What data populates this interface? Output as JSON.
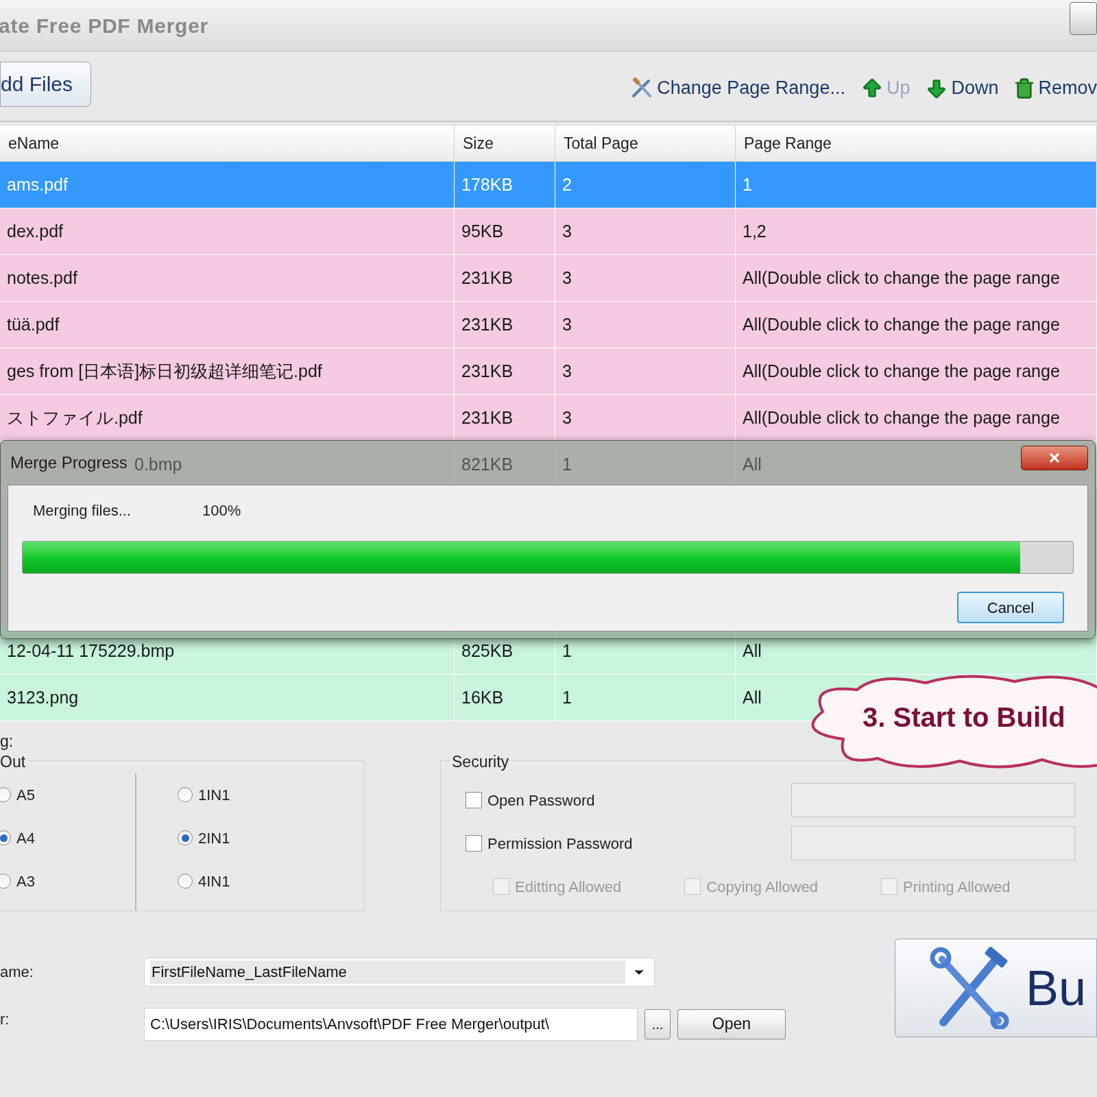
{
  "window": {
    "title": "ate Free PDF Merger"
  },
  "toolbar": {
    "add_button": "dd Files",
    "actions": [
      {
        "kind": "range",
        "label": "Change Page Range...",
        "disabled": false
      },
      {
        "kind": "up",
        "label": "Up",
        "disabled": true
      },
      {
        "kind": "down",
        "label": "Down",
        "disabled": false
      },
      {
        "kind": "remove",
        "label": "Remov",
        "disabled": false
      }
    ]
  },
  "table": {
    "columns": [
      "eName",
      "Size",
      "Total Page",
      "Page Range"
    ],
    "rows": [
      {
        "cells": [
          "ams.pdf",
          "178KB",
          "2",
          "1"
        ],
        "selected": true
      },
      {
        "cells": [
          "dex.pdf",
          "95KB",
          "3",
          "1,2"
        ],
        "selected": false,
        "color": "#f4cbe0"
      },
      {
        "cells": [
          " notes.pdf",
          "231KB",
          "3",
          "All(Double click to change the page range"
        ],
        "selected": false,
        "color": "#f4cbe0"
      },
      {
        "cells": [
          "tüä.pdf",
          "231KB",
          "3",
          "All(Double click to change the page range"
        ],
        "selected": false,
        "color": "#f4cbe0"
      },
      {
        "cells": [
          "ges from [日本语]标日初级超详细笔记.pdf",
          "231KB",
          "3",
          "All(Double click to change the page range"
        ],
        "selected": false,
        "color": "#f4cbe0"
      },
      {
        "cells": [
          "ストファイル.pdf",
          "231KB",
          "3",
          "All(Double click to change the page range"
        ],
        "selected": false,
        "color": "#f4cbe0"
      },
      {
        "cells": [
          "0.bmp",
          "821KB",
          "1",
          "All"
        ],
        "selected": false,
        "color": "#e6dfe2",
        "kind": "under_title"
      },
      {
        "cells": [
          "12-04-11 175229.bmp",
          "825KB",
          "1",
          "All"
        ],
        "selected": false,
        "color": "#c8f5dc"
      },
      {
        "cells": [
          "3123.png",
          "16KB",
          "1",
          "All"
        ],
        "selected": false,
        "color": "#c8f5dc"
      }
    ]
  },
  "dialog": {
    "title": "Merge Progress",
    "close": "×",
    "status": "Merging files...",
    "reading": "100%",
    "level": 0.95,
    "cancel": "Cancel"
  },
  "settings": {
    "label": "g:",
    "layout": {
      "title": "Out",
      "sizes": [
        {
          "label": "A5",
          "selected": false
        },
        {
          "label": "A4",
          "selected": true
        },
        {
          "label": "A3",
          "selected": false
        }
      ],
      "pages": [
        {
          "label": "1IN1",
          "selected": false
        },
        {
          "label": "2IN1",
          "selected": true
        },
        {
          "label": "4IN1",
          "selected": false
        }
      ]
    },
    "security": {
      "title": "Security",
      "passwords": [
        {
          "label": "Open Password",
          "checked": false
        },
        {
          "label": "Permission Password",
          "checked": false
        }
      ],
      "permissions": [
        {
          "label": "Editting Allowed",
          "checked": false,
          "disabled": true
        },
        {
          "label": "Copying Allowed",
          "checked": false,
          "disabled": true
        },
        {
          "label": "Printing Allowed",
          "checked": false,
          "disabled": true
        }
      ]
    }
  },
  "output": {
    "name_label": "ame:",
    "name_value": "FirstFileName_LastFileName",
    "folder_label": "r:",
    "folder_value": "C:\\Users\\IRIS\\Documents\\Anvsoft\\PDF Free Merger\\output\\",
    "browse": "...",
    "open": "Open",
    "build": "Bu"
  },
  "callout": "3. Start to Build"
}
